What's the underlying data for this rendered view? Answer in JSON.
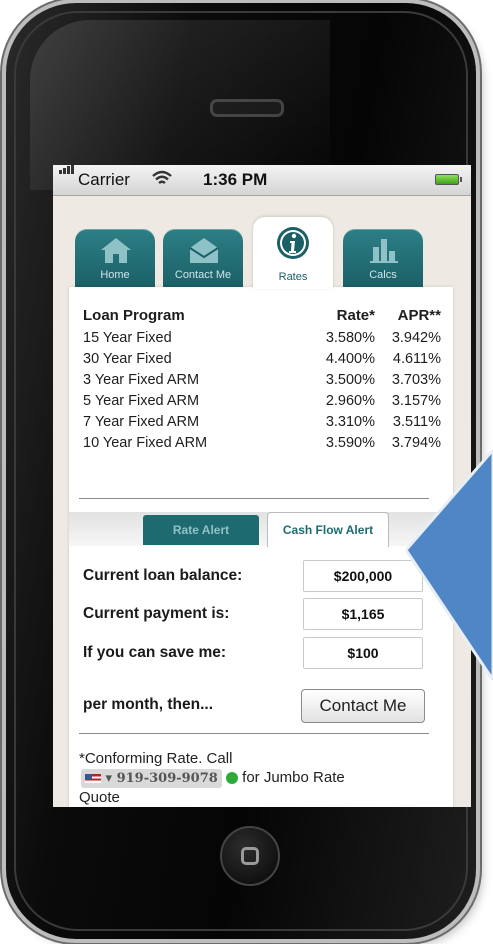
{
  "status": {
    "carrier": "Carrier",
    "time": "1:36 PM"
  },
  "tabs": [
    {
      "label": "Home",
      "icon": "home-icon"
    },
    {
      "label": "Contact Me",
      "icon": "envelope-icon"
    },
    {
      "label": "Rates",
      "icon": "info-icon",
      "active": true
    },
    {
      "label": "Calcs",
      "icon": "bar-chart-icon"
    }
  ],
  "rates": {
    "header": {
      "program": "Loan Program",
      "rate": "Rate*",
      "apr": "APR**"
    },
    "rows": [
      {
        "program": "15 Year Fixed",
        "rate": "3.580%",
        "apr": "3.942%"
      },
      {
        "program": "30 Year Fixed",
        "rate": "4.400%",
        "apr": "4.611%"
      },
      {
        "program": "3 Year Fixed ARM",
        "rate": "3.500%",
        "apr": "3.703%"
      },
      {
        "program": "5 Year Fixed ARM",
        "rate": "2.960%",
        "apr": "3.157%"
      },
      {
        "program": "7 Year Fixed ARM",
        "rate": "3.310%",
        "apr": "3.511%"
      },
      {
        "program": "10 Year Fixed ARM",
        "rate": "3.590%",
        "apr": "3.794%"
      }
    ]
  },
  "alert_tabs": {
    "rate_alert": "Rate Alert",
    "cash_flow_alert": "Cash Flow Alert"
  },
  "form": {
    "balance_label": "Current loan balance:",
    "balance_value": "$200,000",
    "payment_label": "Current payment is:",
    "payment_value": "$1,165",
    "save_label": "If you can save me:",
    "save_value": "$100",
    "per_month": "per month, then...",
    "contact_button": "Contact Me"
  },
  "footnote": {
    "line1": "*Conforming Rate. Call",
    "phone": "919-309-9078",
    "line2": "for Jumbo Rate",
    "line3": "Quote"
  },
  "colors": {
    "teal": "#1d6b71",
    "arrow": "#4f86c6"
  }
}
